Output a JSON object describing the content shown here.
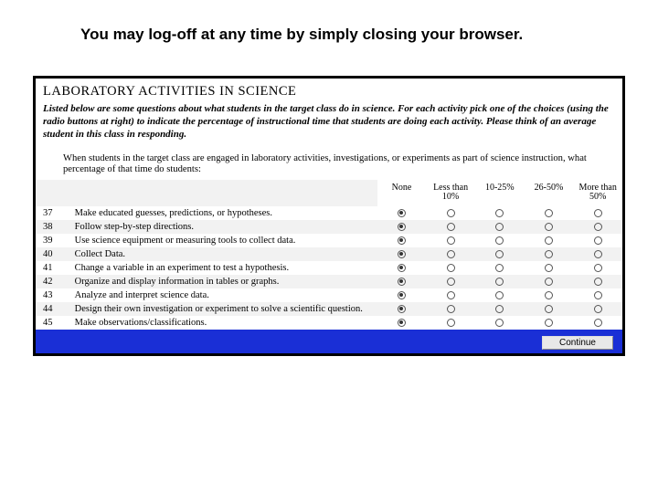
{
  "banner": "You may log-off at any time by simply closing your browser.",
  "section_title": "LABORATORY ACTIVITIES IN SCIENCE",
  "intro": "Listed below are some questions about what students in the target class do in science. For each activity pick one of the choices (using the radio buttons at right) to indicate the percentage of instructional time that students are doing each activity. Please think of an average student in this class in responding.",
  "prompt": "When students in the target class are engaged in laboratory activities, investigations, or experiments as part of science instruction, what percentage of that time do students:",
  "columns": [
    "None",
    "Less than 10%",
    "10-25%",
    "26-50%",
    "More than 50%"
  ],
  "rows": [
    {
      "num": "37",
      "text": "Make educated guesses, predictions, or hypotheses.",
      "selected": 0
    },
    {
      "num": "38",
      "text": "Follow step-by-step directions.",
      "selected": 0
    },
    {
      "num": "39",
      "text": "Use science equipment or measuring tools to collect data.",
      "selected": 0
    },
    {
      "num": "40",
      "text": "Collect Data.",
      "selected": 0
    },
    {
      "num": "41",
      "text": "Change a variable in an experiment to test a hypothesis.",
      "selected": 0
    },
    {
      "num": "42",
      "text": "Organize and display information in tables or graphs.",
      "selected": 0
    },
    {
      "num": "43",
      "text": "Analyze and interpret science data.",
      "selected": 0
    },
    {
      "num": "44",
      "text": "Design their own investigation or experiment to solve a scientific question.",
      "selected": 0
    },
    {
      "num": "45",
      "text": "Make observations/classifications.",
      "selected": 0
    }
  ],
  "continue_label": "Continue"
}
